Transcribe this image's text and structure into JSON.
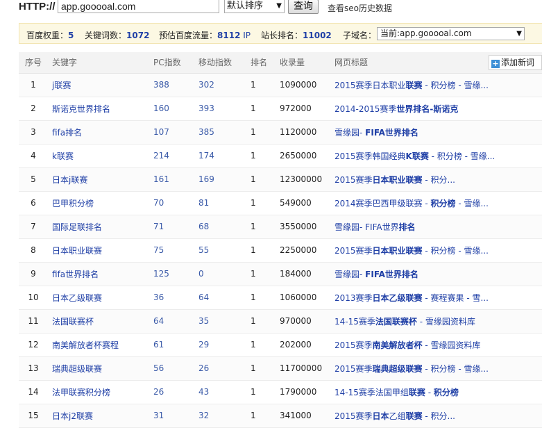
{
  "toolbar": {
    "http_label": "HTTP://",
    "url_value": "app.gooooal.com",
    "sort_selected": "默认排序",
    "query_label": "查询",
    "history_link": "查看seo历史数据"
  },
  "infobar": {
    "baidu_weight_label": "百度权重：",
    "baidu_weight_value": "5",
    "keywords_label": "关键词数：",
    "keywords_value": "1072",
    "traffic_label": "预估百度流量：",
    "traffic_value": "8112",
    "traffic_unit": "IP",
    "site_rank_label": "站长排名：",
    "site_rank_value": "11002",
    "subdomain_label": "子域名：",
    "subdomain_selected": "当前:app.gooooal.com"
  },
  "table": {
    "headers": {
      "idx": "序号",
      "keyword": "关键字",
      "pc": "PC指数",
      "mobile": "移动指数",
      "rank": "排名",
      "indexed": "收录量",
      "title": "网页标题"
    },
    "add_button": "添加新词",
    "rows": [
      {
        "idx": "1",
        "keyword": "j联赛",
        "pc": "388",
        "mobile": "302",
        "rank": "1",
        "indexed": "1090000",
        "title": [
          [
            "2015赛季日本职业",
            false
          ],
          [
            "联赛",
            true
          ],
          [
            " - 积分榜 - 雪缘...",
            false
          ]
        ]
      },
      {
        "idx": "2",
        "keyword": "斯诺克世界排名",
        "pc": "160",
        "mobile": "393",
        "rank": "1",
        "indexed": "972000",
        "title": [
          [
            "2014-2015赛季",
            false
          ],
          [
            "世界排名-斯诺克",
            true
          ]
        ]
      },
      {
        "idx": "3",
        "keyword": "fifa排名",
        "pc": "107",
        "mobile": "385",
        "rank": "1",
        "indexed": "1120000",
        "title": [
          [
            "雪缘园- ",
            false
          ],
          [
            "FIFA世界排名",
            true
          ]
        ]
      },
      {
        "idx": "4",
        "keyword": "k联赛",
        "pc": "214",
        "mobile": "174",
        "rank": "1",
        "indexed": "2650000",
        "title": [
          [
            "2015赛季韩国经典",
            false
          ],
          [
            "K联赛",
            true
          ],
          [
            " - 积分榜 - 雪缘...",
            false
          ]
        ]
      },
      {
        "idx": "5",
        "keyword": "日本j联赛",
        "pc": "161",
        "mobile": "169",
        "rank": "1",
        "indexed": "12300000",
        "title": [
          [
            "2015赛季",
            false
          ],
          [
            "日本职业联赛",
            true
          ],
          [
            " - 积分...",
            false
          ]
        ]
      },
      {
        "idx": "6",
        "keyword": "巴甲积分榜",
        "pc": "70",
        "mobile": "81",
        "rank": "1",
        "indexed": "549000",
        "title": [
          [
            "2014赛季巴西甲级联赛 - ",
            false
          ],
          [
            "积分榜",
            true
          ],
          [
            " - 雪缘...",
            false
          ]
        ]
      },
      {
        "idx": "7",
        "keyword": "国际足联排名",
        "pc": "71",
        "mobile": "68",
        "rank": "1",
        "indexed": "3550000",
        "title": [
          [
            "雪缘园- FIFA世界",
            false
          ],
          [
            "排名",
            true
          ]
        ]
      },
      {
        "idx": "8",
        "keyword": "日本职业联赛",
        "pc": "75",
        "mobile": "55",
        "rank": "1",
        "indexed": "2250000",
        "title": [
          [
            "2015赛季",
            false
          ],
          [
            "日本职业联赛",
            true
          ],
          [
            " - 积分榜 - 雪缘...",
            false
          ]
        ]
      },
      {
        "idx": "9",
        "keyword": "fifa世界排名",
        "pc": "125",
        "mobile": "0",
        "rank": "1",
        "indexed": "184000",
        "title": [
          [
            "雪缘园- ",
            false
          ],
          [
            "FIFA世界排名",
            true
          ]
        ]
      },
      {
        "idx": "10",
        "keyword": "日本乙级联赛",
        "pc": "36",
        "mobile": "64",
        "rank": "1",
        "indexed": "1060000",
        "title": [
          [
            "2013赛季",
            false
          ],
          [
            "日本乙级联赛",
            true
          ],
          [
            " - 赛程赛果 - 雪...",
            false
          ]
        ]
      },
      {
        "idx": "11",
        "keyword": "法国联赛杯",
        "pc": "64",
        "mobile": "35",
        "rank": "1",
        "indexed": "970000",
        "title": [
          [
            "14-15赛季",
            false
          ],
          [
            "法国联赛杯",
            true
          ],
          [
            " - 雪缘园资料库",
            false
          ]
        ]
      },
      {
        "idx": "12",
        "keyword": "南美解放者杯赛程",
        "pc": "61",
        "mobile": "29",
        "rank": "1",
        "indexed": "202000",
        "title": [
          [
            "2015赛季",
            false
          ],
          [
            "南美解放者杯",
            true
          ],
          [
            " - 雪缘园资料库",
            false
          ]
        ]
      },
      {
        "idx": "13",
        "keyword": "瑞典超级联赛",
        "pc": "56",
        "mobile": "26",
        "rank": "1",
        "indexed": "11700000",
        "title": [
          [
            "2015赛季",
            false
          ],
          [
            "瑞典超级联赛",
            true
          ],
          [
            " - 积分榜 - 雪缘...",
            false
          ]
        ]
      },
      {
        "idx": "14",
        "keyword": "法甲联赛积分榜",
        "pc": "26",
        "mobile": "43",
        "rank": "1",
        "indexed": "1790000",
        "title": [
          [
            "14-15赛季法国甲组",
            false
          ],
          [
            "联赛",
            true
          ],
          [
            " - ",
            false
          ],
          [
            "积分榜",
            true
          ]
        ]
      },
      {
        "idx": "15",
        "keyword": "日本j2联赛",
        "pc": "31",
        "mobile": "32",
        "rank": "1",
        "indexed": "341000",
        "title": [
          [
            "2015赛季",
            false
          ],
          [
            "日本",
            true
          ],
          [
            "乙组",
            false
          ],
          [
            "联赛",
            true
          ],
          [
            " - 积分...",
            false
          ]
        ]
      }
    ]
  }
}
